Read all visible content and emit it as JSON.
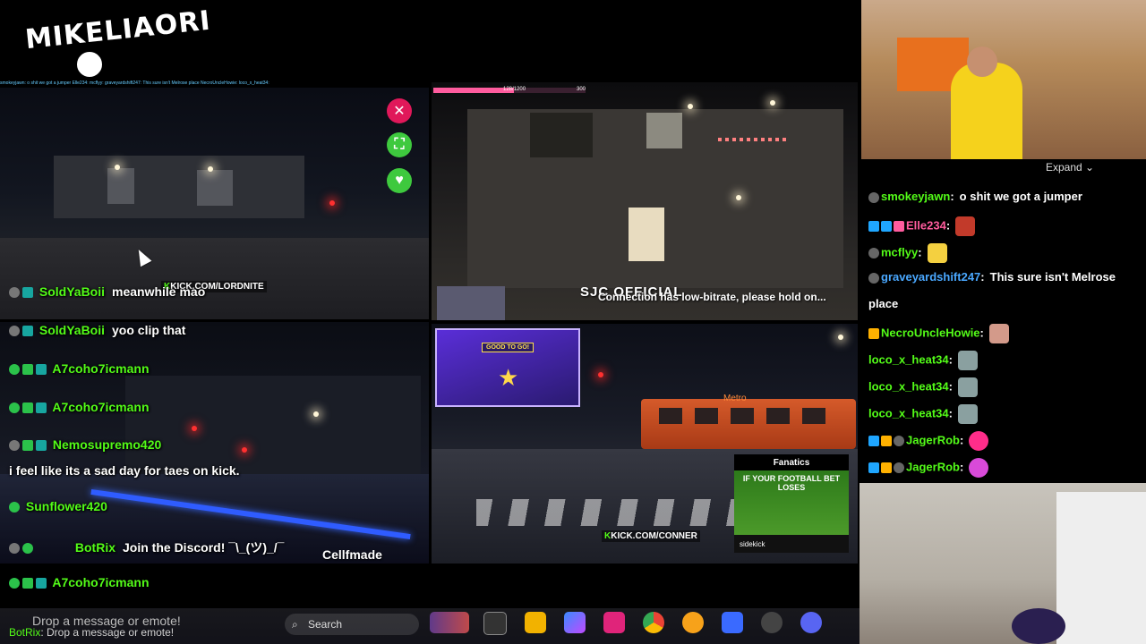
{
  "logo": {
    "text": "MIKELIAORI"
  },
  "ticker": "smokeyjawn: o shit we got a jumper  Elle234:  mcflyy:  graveyardshift247: This sure isn't Melrose place  NecroUncleHowie:  loco_x_heat34:",
  "panel_top_right": {
    "progress_text": "128/1200",
    "progress_max": "300",
    "progress_fraction": 0.53,
    "watermark": "SJC OFFICIAL",
    "status": "Connection has low-bitrate, please hold on..."
  },
  "panel_top_left": {
    "kick_tag": "KICK.COM/LORDNITE"
  },
  "panel_bottom_right": {
    "kick_tag": "KICK.COM/CONNER",
    "game_card_title": "GOOD TO GO!",
    "bus_sign": "Metro",
    "ad": {
      "brand": "Fanatics",
      "headline": "IF YOUR FOOTBALL BET LOSES",
      "footer": "sidekick"
    }
  },
  "overlay_chat": [
    {
      "user": "SoldYaBoii",
      "message": "meanwhile mao"
    },
    {
      "user": "SoldYaBoii",
      "message": "yoo clip that"
    },
    {
      "user": "A7coho7icmann",
      "message": ""
    },
    {
      "user": "A7coho7icmann",
      "message": ""
    },
    {
      "user": "Nemosupremo420",
      "message": ""
    },
    {
      "user": "",
      "message": "i feel like its a sad day for taes on kick."
    },
    {
      "user": "Sunflower420",
      "message": ""
    },
    {
      "user": "BotRix",
      "message": "Join the Discord! ¯\\_(ツ)_/¯"
    },
    {
      "user": "A7coho7icmann",
      "message": ""
    }
  ],
  "cellfmade": "Cellfmade",
  "right_chat": {
    "expand_label": "Expand",
    "rows": [
      {
        "user": "smokeyjawn",
        "message": "o shit we got a jumper",
        "color": "#53fc18"
      },
      {
        "user": "Elle234",
        "message": "",
        "color": "#ff5c9e"
      },
      {
        "user": "mcflyy",
        "message": "",
        "color": "#53fc18"
      },
      {
        "user": "graveyardshift247",
        "message": "This sure isn't Melrose",
        "color": "#4aa8ff"
      },
      {
        "user": "",
        "message": "place",
        "color": "#fff"
      },
      {
        "user": "NecroUncleHowie",
        "message": "",
        "color": "#53fc18"
      },
      {
        "user": "loco_x_heat34",
        "message": "",
        "color": "#53fc18"
      },
      {
        "user": "loco_x_heat34",
        "message": "",
        "color": "#53fc18"
      },
      {
        "user": "loco_x_heat34",
        "message": "",
        "color": "#53fc18"
      },
      {
        "user": "JagerRob",
        "message": "",
        "color": "#53fc18"
      },
      {
        "user": "JagerRob",
        "message": "",
        "color": "#53fc18"
      }
    ]
  },
  "chat_input": {
    "placeholder": "Drop a message or emote!"
  },
  "bottom_chat": {
    "user": "BotRix",
    "message": "Drop a message or emote!"
  },
  "taskbar": {
    "search_placeholder": "Search"
  },
  "colors": {
    "kick_green": "#53fc18",
    "close_pink": "#e0185a",
    "button_green": "#3ec93e"
  }
}
